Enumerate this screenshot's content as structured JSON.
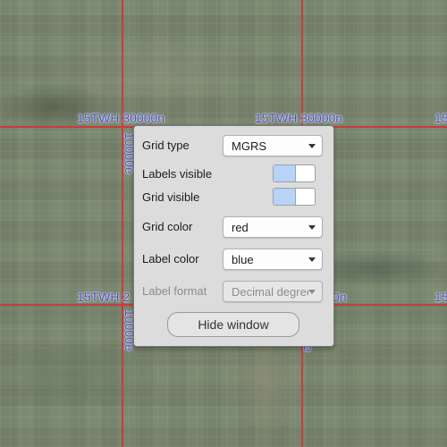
{
  "map": {
    "grid_color": "#cc3b3b",
    "label_color": "#4a4fb8",
    "labels": {
      "a": "15TWH 30000n",
      "b": "15TWH 30000n",
      "c": "15",
      "d": "15TWH 2",
      "e": "0n",
      "f": "15",
      "g": "10000e",
      "h": "10000e",
      "i": "e"
    }
  },
  "panel": {
    "grid_type": {
      "label": "Grid type",
      "value": "MGRS"
    },
    "labels_visible": {
      "label": "Labels visible",
      "checked": true
    },
    "grid_visible": {
      "label": "Grid visible",
      "checked": true
    },
    "grid_color": {
      "label": "Grid color",
      "value": "red"
    },
    "label_color": {
      "label": "Label color",
      "value": "blue"
    },
    "label_format": {
      "label": "Label format",
      "value": "Decimal degrees",
      "disabled": true
    },
    "hide_button": "Hide window"
  }
}
